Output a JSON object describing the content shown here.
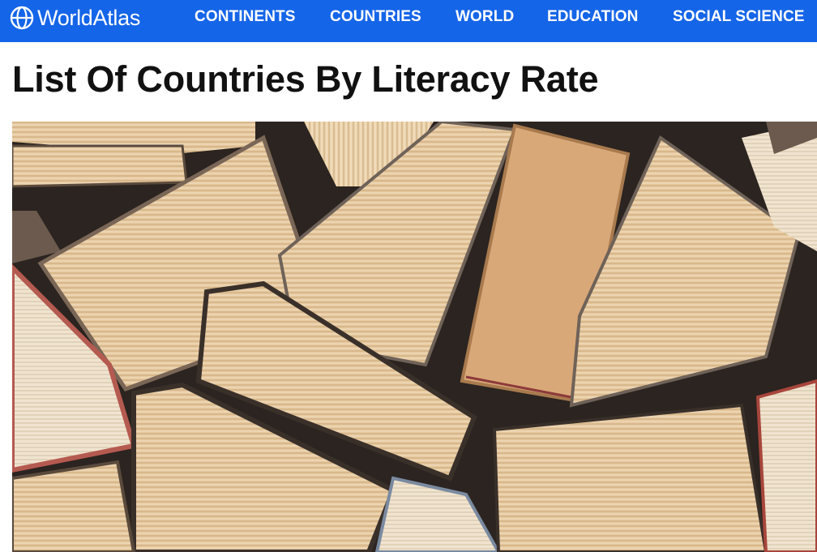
{
  "site": {
    "name": "WorldAtlas",
    "logo_icon": "globe-icon",
    "brand_color": "#1565e8"
  },
  "nav": {
    "items": [
      {
        "label": "CONTINENTS"
      },
      {
        "label": "COUNTRIES"
      },
      {
        "label": "WORLD"
      },
      {
        "label": "EDUCATION"
      },
      {
        "label": "SOCIAL SCIENCE"
      }
    ]
  },
  "article": {
    "title": "List Of Countries By Literacy Rate",
    "hero_image": "stack-of-open-books-photo"
  }
}
